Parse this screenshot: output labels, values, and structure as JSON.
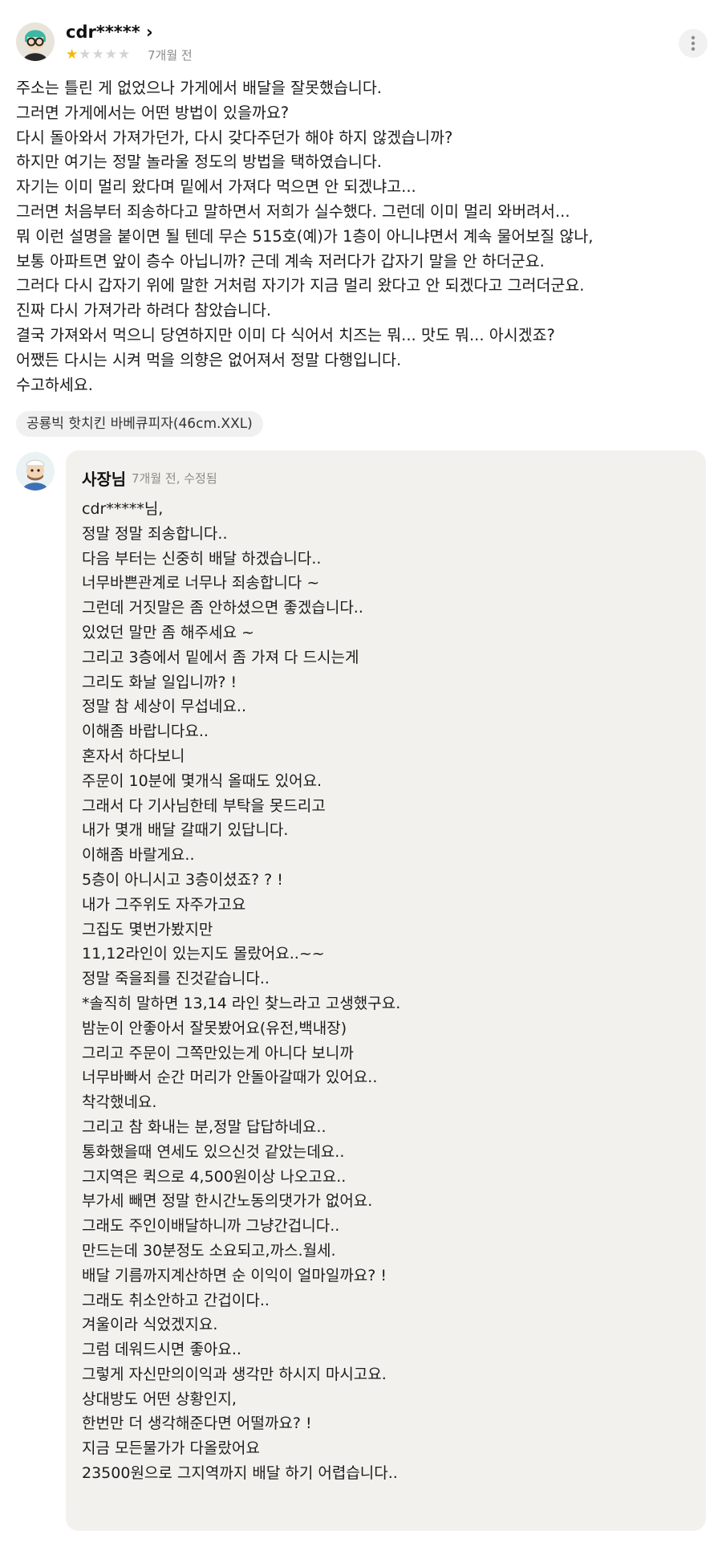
{
  "review": {
    "user_name": "cdr***** ›",
    "rating": 1,
    "rating_max": 5,
    "date": "7개월 전",
    "body_lines": [
      "주소는 틀린 게 없었으나 가게에서 배달을 잘못했습니다.",
      "그러면 가게에서는 어떤 방법이 있을까요?",
      "다시 돌아와서 가져가던가, 다시 갖다주던가 해야 하지 않겠습니까?",
      "하지만 여기는 정말 놀라울 정도의 방법을 택하였습니다.",
      "자기는 이미 멀리 왔다며 밑에서 가져다 먹으면 안 되겠냐고...",
      "그러면 처음부터 죄송하다고 말하면서 저희가 실수했다. 그런데 이미 멀리 와버려서...",
      "뭐 이런 설명을 붙이면 될 텐데 무슨 515호(예)가 1층이 아니냐면서 계속 물어보질 않나,",
      "보통 아파트면 앞이 층수 아닙니까? 근데 계속 저러다가 갑자기 말을 안 하더군요.",
      "그러다 다시 갑자기 위에 말한 거처럼 자기가 지금 멀리 왔다고 안 되겠다고 그러더군요.",
      "진짜 다시 가져가라 하려다 참았습니다.",
      "결국 가져와서 먹으니 당연하지만 이미 다 식어서 치즈는 뭐... 맛도 뭐... 아시겠죠?",
      "어쨌든 다시는 시켜 먹을 의향은 없어져서 정말 다행입니다.",
      "수고하세요."
    ],
    "menu_item": "공룡빅 핫치킨 바베큐피자(46cm.XXL)"
  },
  "reply": {
    "author": "사장님",
    "meta": "7개월 전, 수정됨",
    "body_lines": [
      "cdr*****님,",
      "정말 정말 죄송합니다..",
      "다음 부터는 신중히 배달 하겠습니다..",
      "너무바쁜관계로 너무나 죄송합니다 ~",
      "그런데 거짓말은 좀 안하셨으면 좋겠습니다..",
      "있었던 말만 좀 해주세요 ~",
      "그리고 3층에서 밑에서 좀 가져 다 드시는게",
      "그리도 화날 일입니까? !",
      "정말 참 세상이 무섭네요..",
      "이해좀 바랍니다요..",
      "혼자서 하다보니",
      "주문이 10분에 몇개식 올때도 있어요.",
      "그래서 다 기사님한테 부탁을 못드리고",
      "내가 몇개 배달 갈때기 있답니다.",
      "이해좀 바랄게요..",
      "5층이 아니시고 3층이셨죠? ? !",
      "내가 그주위도 자주가고요",
      "그집도 몇번가봤지만",
      "11,12라인이 있는지도 몰랐어요..~~",
      "정말 죽을죄를 진것같습니다..",
      "*솔직히 말하면 13,14 라인 찾느라고 고생했구요.",
      "밤눈이 안좋아서 잘못봤어요(유전,백내장)",
      "그리고 주문이 그쪽만있는게 아니다 보니까",
      "너무바빠서 순간 머리가 안돌아갈때가 있어요..",
      "착각했네요.",
      "그리고 참 화내는 분,정말 답답하네요..",
      "통화했을때 연세도 있으신것 같았는데요..",
      "그지역은 퀵으로 4,500원이상 나오고요..",
      "부가세 빼면 정말 한시간노동의댓가가 없어요.",
      "그래도 주인이배달하니까 그냥간겁니다..",
      "만드는데 30분정도 소요되고,까스.월세.",
      "배달 기름까지계산하면 순 이익이 얼마일까요? !",
      "그래도 취소안하고 간겁이다..",
      "겨울이라 식었겠지요.",
      "그럼 데워드시면 좋아요..",
      "그렇게 자신만의이익과 생각만 하시지 마시고요.",
      "상대방도 어떤 상황인지,",
      "한번만 더 생각해준다면 어떨까요? !",
      "지금 모든물가가 다올랐어요",
      "23500원으로 그지역까지 배달 하기 어렵습니다.."
    ]
  },
  "icons": {
    "user_avatar": "person-with-glasses-avatar-icon",
    "owner_avatar": "cartoon-chef-avatar-icon",
    "more": "more-vertical-icon",
    "star": "star-icon"
  },
  "colors": {
    "star_filled": "#f5b800",
    "star_empty": "#d4d4d4",
    "reply_background": "#f3f1ed",
    "muted_text": "#8a8a8a"
  }
}
